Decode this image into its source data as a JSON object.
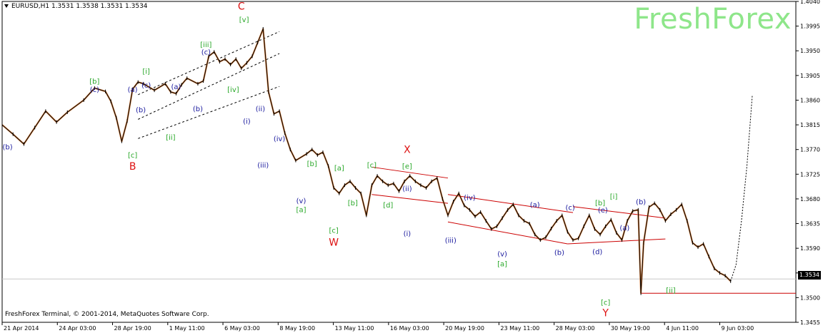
{
  "header": {
    "title": "EURUSD,H1  1.3531 1.3538 1.3531 1.3534",
    "watermark": "FreshForex",
    "copyright": "FreshForex Terminal, © 2001-2014, MetaQuotes Software Corp."
  },
  "colors": {
    "background": "#ffffff",
    "price_line": "#000000",
    "candle_accent": "#d26a1c",
    "channel_black": "#000000",
    "channel_red": "#cc0000",
    "label_blue": "#1a1a9e",
    "label_green": "#2aa82a",
    "label_red": "#dd1111",
    "watermark": "#8ee68a"
  },
  "chart_data": {
    "type": "line",
    "symbol": "EURUSD",
    "timeframe": "H1",
    "last_price": "1.3534",
    "ylim": [
      1.3455,
      1.404
    ],
    "y_ticks": [
      "1.4040",
      "1.3995",
      "1.3950",
      "1.3905",
      "1.3860",
      "1.3815",
      "1.3770",
      "1.3725",
      "1.3680",
      "1.3635",
      "1.3590",
      "1.3545",
      "1.3500",
      "1.3455"
    ],
    "x_ticks": [
      "21 Apr 2014",
      "24 Apr 03:00",
      "28 Apr 19:00",
      "1 May 11:00",
      "6 May 03:00",
      "8 May 19:00",
      "13 May 11:00",
      "16 May 03:00",
      "20 May 19:00",
      "23 May 11:00",
      "28 May 03:00",
      "30 May 19:00",
      "4 Jun 11:00",
      "9 Jun 03:00"
    ],
    "series": [
      {
        "values": [
          [
            0,
            1.3815
          ],
          [
            2,
            1.3798
          ],
          [
            4,
            1.378
          ],
          [
            6,
            1.381
          ],
          [
            8,
            1.384
          ],
          [
            10,
            1.382
          ],
          [
            12,
            1.3838
          ],
          [
            15,
            1.386
          ],
          [
            17,
            1.3882
          ],
          [
            19,
            1.3876
          ],
          [
            20,
            1.3858
          ],
          [
            21,
            1.3828
          ],
          [
            22,
            1.3785
          ],
          [
            23,
            1.3822
          ],
          [
            24,
            1.388
          ],
          [
            25,
            1.3893
          ],
          [
            26,
            1.389
          ],
          [
            28,
            1.3878
          ],
          [
            30,
            1.389
          ],
          [
            31,
            1.3875
          ],
          [
            32,
            1.3872
          ],
          [
            33,
            1.3888
          ],
          [
            34,
            1.39
          ],
          [
            36,
            1.389
          ],
          [
            37,
            1.3895
          ],
          [
            38,
            1.394
          ],
          [
            39,
            1.3948
          ],
          [
            40,
            1.393
          ],
          [
            41,
            1.3935
          ],
          [
            42,
            1.3925
          ],
          [
            43,
            1.3935
          ],
          [
            44,
            1.3918
          ],
          [
            45,
            1.3928
          ],
          [
            46,
            1.394
          ],
          [
            47,
            1.3965
          ],
          [
            48,
            1.399
          ],
          [
            49,
            1.3875
          ],
          [
            50,
            1.3835
          ],
          [
            51,
            1.384
          ],
          [
            52,
            1.38
          ],
          [
            53,
            1.377
          ],
          [
            54,
            1.375
          ],
          [
            56,
            1.3762
          ],
          [
            57,
            1.377
          ],
          [
            58,
            1.376
          ],
          [
            59,
            1.3765
          ],
          [
            60,
            1.374
          ],
          [
            61,
            1.37
          ],
          [
            62,
            1.369
          ],
          [
            63,
            1.3705
          ],
          [
            64,
            1.3712
          ],
          [
            65,
            1.37
          ],
          [
            66,
            1.369
          ],
          [
            67,
            1.365
          ],
          [
            68,
            1.3705
          ],
          [
            69,
            1.3722
          ],
          [
            70,
            1.3712
          ],
          [
            71,
            1.3705
          ],
          [
            72,
            1.3708
          ],
          [
            73,
            1.3694
          ],
          [
            74,
            1.3712
          ],
          [
            75,
            1.3722
          ],
          [
            76,
            1.3712
          ],
          [
            77,
            1.3705
          ],
          [
            78,
            1.37
          ],
          [
            79,
            1.3712
          ],
          [
            80,
            1.3718
          ],
          [
            81,
            1.368
          ],
          [
            82,
            1.365
          ],
          [
            83,
            1.3675
          ],
          [
            84,
            1.369
          ],
          [
            85,
            1.3668
          ],
          [
            86,
            1.366
          ],
          [
            87,
            1.3648
          ],
          [
            88,
            1.3656
          ],
          [
            89,
            1.364
          ],
          [
            90,
            1.3625
          ],
          [
            91,
            1.363
          ],
          [
            92,
            1.3645
          ],
          [
            93,
            1.366
          ],
          [
            94,
            1.367
          ],
          [
            95,
            1.365
          ],
          [
            96,
            1.364
          ],
          [
            97,
            1.3635
          ],
          [
            98,
            1.3615
          ],
          [
            99,
            1.3605
          ],
          [
            100,
            1.361
          ],
          [
            101,
            1.3626
          ],
          [
            102,
            1.364
          ],
          [
            103,
            1.365
          ],
          [
            104,
            1.362
          ],
          [
            105,
            1.3605
          ],
          [
            106,
            1.3608
          ],
          [
            107,
            1.363
          ],
          [
            108,
            1.365
          ],
          [
            109,
            1.3625
          ],
          [
            110,
            1.3615
          ],
          [
            111,
            1.363
          ],
          [
            112,
            1.3642
          ],
          [
            113,
            1.3618
          ],
          [
            114,
            1.3605
          ],
          [
            115,
            1.364
          ],
          [
            116,
            1.3658
          ],
          [
            117,
            1.366
          ],
          [
            117.5,
            1.3508
          ],
          [
            118,
            1.36
          ],
          [
            119,
            1.3665
          ],
          [
            120,
            1.3672
          ],
          [
            121,
            1.366
          ],
          [
            122,
            1.364
          ],
          [
            123,
            1.3652
          ],
          [
            124,
            1.366
          ],
          [
            125,
            1.367
          ],
          [
            126,
            1.364
          ],
          [
            127,
            1.36
          ],
          [
            128,
            1.3592
          ],
          [
            129,
            1.3598
          ],
          [
            130,
            1.3575
          ],
          [
            131,
            1.3553
          ],
          [
            132,
            1.3545
          ],
          [
            133,
            1.354
          ],
          [
            134,
            1.353
          ]
        ]
      }
    ],
    "forecast": [
      [
        134,
        1.353
      ],
      [
        135,
        1.356
      ],
      [
        136,
        1.364
      ],
      [
        137,
        1.374
      ],
      [
        138,
        1.387
      ]
    ],
    "channels": [
      {
        "color": "black",
        "from": [
          25,
          1.387
        ],
        "to": [
          51,
          1.3985
        ]
      },
      {
        "color": "black",
        "from": [
          25,
          1.3825
        ],
        "to": [
          51,
          1.3945
        ]
      },
      {
        "color": "black",
        "from": [
          25,
          1.379
        ],
        "to": [
          51,
          1.3885
        ]
      },
      {
        "color": "red",
        "from": [
          68,
          1.3738
        ],
        "to": [
          82,
          1.3718
        ]
      },
      {
        "color": "red",
        "from": [
          68,
          1.3688
        ],
        "to": [
          82,
          1.3672
        ]
      },
      {
        "color": "red",
        "from": [
          82,
          1.3688
        ],
        "to": [
          105,
          1.3655
        ]
      },
      {
        "color": "red",
        "from": [
          82,
          1.3638
        ],
        "to": [
          104,
          1.3598
        ]
      },
      {
        "color": "red",
        "from": [
          105,
          1.3666
        ],
        "to": [
          122,
          1.3645
        ]
      },
      {
        "color": "red",
        "from": [
          104,
          1.3598
        ],
        "to": [
          122,
          1.3607
        ]
      },
      {
        "color": "red",
        "from": [
          117.5,
          1.3508
        ],
        "to": [
          146,
          1.3508
        ]
      }
    ],
    "wave_labels": [
      {
        "text": "(b)",
        "color": "blue",
        "x": 1,
        "y": 1.377
      },
      {
        "text": "[b]",
        "color": "green",
        "x": 17,
        "y": 1.389
      },
      {
        "text": "(c)",
        "color": "blue",
        "x": 17,
        "y": 1.3875
      },
      {
        "text": "[c]",
        "color": "green",
        "x": 24,
        "y": 1.3755
      },
      {
        "text": "B",
        "color": "red",
        "x": 24,
        "y": 1.3733
      },
      {
        "text": "(a)",
        "color": "blue",
        "x": 24,
        "y": 1.3875
      },
      {
        "text": "(b)",
        "color": "blue",
        "x": 25.5,
        "y": 1.3838
      },
      {
        "text": "[i]",
        "color": "green",
        "x": 26.5,
        "y": 1.3908
      },
      {
        "text": "(c)",
        "color": "blue",
        "x": 26.5,
        "y": 1.3883
      },
      {
        "text": "(a)",
        "color": "blue",
        "x": 32,
        "y": 1.388
      },
      {
        "text": "[ii]",
        "color": "green",
        "x": 31,
        "y": 1.3788
      },
      {
        "text": "(b)",
        "color": "blue",
        "x": 36,
        "y": 1.384
      },
      {
        "text": "[iii]",
        "color": "green",
        "x": 37.5,
        "y": 1.3957
      },
      {
        "text": "(c)",
        "color": "blue",
        "x": 37.5,
        "y": 1.3943
      },
      {
        "text": "[iv]",
        "color": "green",
        "x": 42.5,
        "y": 1.3875
      },
      {
        "text": "C",
        "color": "red",
        "x": 44,
        "y": 1.4025
      },
      {
        "text": "[v]",
        "color": "green",
        "x": 44.5,
        "y": 1.4002
      },
      {
        "text": "(ii)",
        "color": "blue",
        "x": 47.5,
        "y": 1.384
      },
      {
        "text": "(i)",
        "color": "blue",
        "x": 45,
        "y": 1.3817
      },
      {
        "text": "(iv)",
        "color": "blue",
        "x": 51,
        "y": 1.3785
      },
      {
        "text": "(iii)",
        "color": "blue",
        "x": 48,
        "y": 1.3737
      },
      {
        "text": "[b]",
        "color": "green",
        "x": 57,
        "y": 1.374
      },
      {
        "text": "[a]",
        "color": "green",
        "x": 62,
        "y": 1.3732
      },
      {
        "text": "[c]",
        "color": "green",
        "x": 68,
        "y": 1.3737
      },
      {
        "text": "X",
        "color": "red",
        "x": 74.5,
        "y": 1.3764
      },
      {
        "text": "[e]",
        "color": "green",
        "x": 74.5,
        "y": 1.3735
      },
      {
        "text": "(v)",
        "color": "blue",
        "x": 55,
        "y": 1.3672
      },
      {
        "text": "[a]",
        "color": "green",
        "x": 55,
        "y": 1.3656
      },
      {
        "text": "[b]",
        "color": "green",
        "x": 64.5,
        "y": 1.3668
      },
      {
        "text": "[d]",
        "color": "green",
        "x": 71,
        "y": 1.3664
      },
      {
        "text": "(ii)",
        "color": "blue",
        "x": 74.5,
        "y": 1.3694
      },
      {
        "text": "(iv)",
        "color": "blue",
        "x": 86,
        "y": 1.3678
      },
      {
        "text": "[c]",
        "color": "green",
        "x": 61,
        "y": 1.3618
      },
      {
        "text": "W",
        "color": "red",
        "x": 61,
        "y": 1.3595
      },
      {
        "text": "(i)",
        "color": "blue",
        "x": 74.5,
        "y": 1.3612
      },
      {
        "text": "(iii)",
        "color": "blue",
        "x": 82.5,
        "y": 1.36
      },
      {
        "text": "(v)",
        "color": "blue",
        "x": 92,
        "y": 1.3575
      },
      {
        "text": "[a]",
        "color": "green",
        "x": 92,
        "y": 1.3557
      },
      {
        "text": "(a)",
        "color": "blue",
        "x": 98,
        "y": 1.3665
      },
      {
        "text": "(c)",
        "color": "blue",
        "x": 104.5,
        "y": 1.366
      },
      {
        "text": "(b)",
        "color": "blue",
        "x": 102.5,
        "y": 1.3578
      },
      {
        "text": "[b]",
        "color": "green",
        "x": 110,
        "y": 1.3668
      },
      {
        "text": "(e)",
        "color": "blue",
        "x": 110.5,
        "y": 1.3655
      },
      {
        "text": "[i]",
        "color": "green",
        "x": 112.5,
        "y": 1.368
      },
      {
        "text": "(b)",
        "color": "blue",
        "x": 117.5,
        "y": 1.367
      },
      {
        "text": "(a)",
        "color": "blue",
        "x": 114.5,
        "y": 1.3623
      },
      {
        "text": "(d)",
        "color": "blue",
        "x": 109.5,
        "y": 1.3579
      },
      {
        "text": "[c]",
        "color": "green",
        "x": 111,
        "y": 1.3487
      },
      {
        "text": "Y",
        "color": "red",
        "x": 111,
        "y": 1.3466
      },
      {
        "text": "[ii]",
        "color": "green",
        "x": 123,
        "y": 1.3509
      }
    ]
  }
}
